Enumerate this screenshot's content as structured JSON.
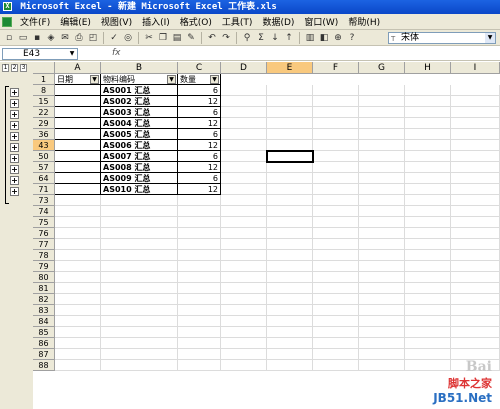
{
  "window": {
    "title": "Microsoft Excel - 新建 Microsoft Excel 工作表.xls"
  },
  "menu": [
    "文件(F)",
    "编辑(E)",
    "视图(V)",
    "插入(I)",
    "格式(O)",
    "工具(T)",
    "数据(D)",
    "窗口(W)",
    "帮助(H)"
  ],
  "toolbar": {
    "font_name": "宋体"
  },
  "formula_bar": {
    "name_box": "E43",
    "fx": "fx",
    "content": ""
  },
  "outline": {
    "levels": [
      "1",
      "2",
      "3"
    ],
    "expand_symbol": "+"
  },
  "columns": [
    "A",
    "B",
    "C",
    "D",
    "E",
    "F",
    "G",
    "H",
    "I"
  ],
  "selected_column": "E",
  "header_row": {
    "row": "1",
    "a": "日期",
    "b": "物料编码",
    "c": "数量"
  },
  "rows": [
    {
      "row": "8",
      "b": "AS001 汇总",
      "c": "6"
    },
    {
      "row": "15",
      "b": "AS002 汇总",
      "c": "12"
    },
    {
      "row": "22",
      "b": "AS003 汇总",
      "c": "6"
    },
    {
      "row": "29",
      "b": "AS004 汇总",
      "c": "12"
    },
    {
      "row": "36",
      "b": "AS005 汇总",
      "c": "6"
    },
    {
      "row": "43",
      "b": "AS006 汇总",
      "c": "12"
    },
    {
      "row": "50",
      "b": "AS007 汇总",
      "c": "6"
    },
    {
      "row": "57",
      "b": "AS008 汇总",
      "c": "12"
    },
    {
      "row": "64",
      "b": "AS009 汇总",
      "c": "6"
    },
    {
      "row": "71",
      "b": "AS010 汇总",
      "c": "12"
    }
  ],
  "empty_rows": [
    "73",
    "74",
    "75",
    "76",
    "77",
    "78",
    "79",
    "80",
    "81",
    "82",
    "83",
    "84",
    "85",
    "86",
    "87",
    "88"
  ],
  "selected_row": "43",
  "watermark": {
    "line1": "Bai",
    "line2": "脚本之家",
    "line3": "JB51.Net"
  }
}
